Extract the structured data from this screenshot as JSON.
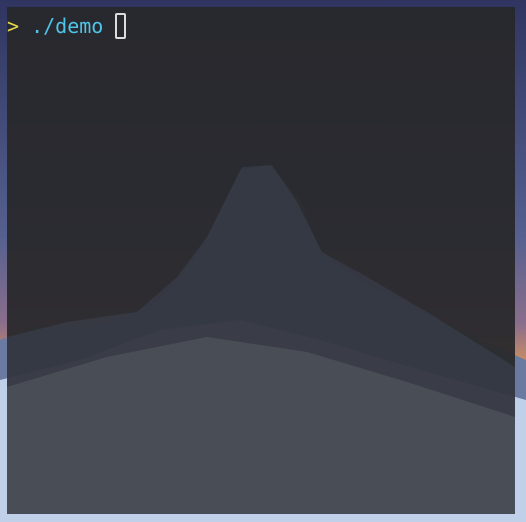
{
  "wallpaper": {
    "description_colors": {
      "sky_top": "#3a3f6a",
      "horizon_glow": "#c08a6a",
      "snow": "#8aa0c0"
    }
  },
  "terminal": {
    "background": "#28282a",
    "prompt_symbol": ">",
    "command_text": "./demo",
    "cursor_style": "block-outline",
    "colors": {
      "prompt": "#e5d94a",
      "command": "#4fc3e8",
      "cursor": "#dcdcdc"
    }
  }
}
